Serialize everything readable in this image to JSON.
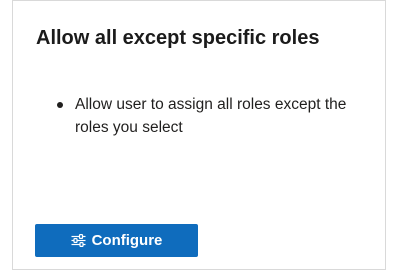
{
  "card": {
    "title": "Allow all except specific roles",
    "bullets": [
      "Allow user to assign all roles except the roles you select"
    ],
    "configure_button": {
      "icon": "sliders-icon",
      "label": "Configure",
      "color": "#0f6cbd"
    }
  }
}
